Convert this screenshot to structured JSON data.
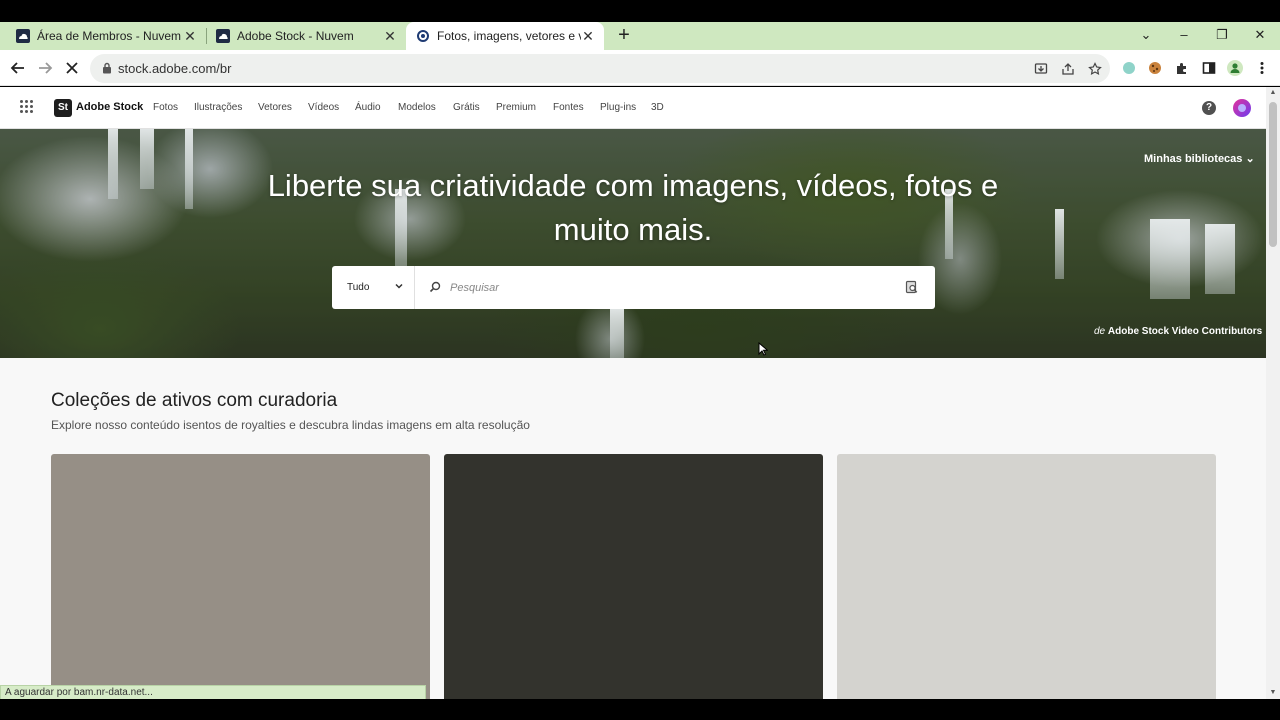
{
  "browser": {
    "tabs": [
      {
        "title": "Área de Membros - Nuvem",
        "active": false
      },
      {
        "title": "Adobe Stock - Nuvem",
        "active": false
      },
      {
        "title": "Fotos, imagens, vetores e vídeos",
        "active": true
      }
    ],
    "address": "stock.adobe.com/br",
    "status_text": "A aguardar por bam.nr-data.net..."
  },
  "header": {
    "logo_text": "St",
    "brand": "Adobe Stock",
    "nav": [
      "Fotos",
      "Ilustrações",
      "Vetores",
      "Vídeos",
      "Áudio",
      "Modelos",
      "Grátis",
      "Premium",
      "Fontes",
      "Plug-ins",
      "3D"
    ],
    "help_label": "?"
  },
  "hero": {
    "title": "Liberte sua criatividade com imagens, vídeos, fotos e muito mais.",
    "libraries": "Minhas bibliotecas",
    "credit_prefix": "de",
    "credit_name": "Adobe Stock Video Contributors",
    "search": {
      "category": "Tudo",
      "placeholder": "Pesquisar"
    }
  },
  "curated": {
    "title": "Coleções de ativos com curadoria",
    "subtitle": "Explore nosso conteúdo isentos de royalties e descubra lindas imagens em alta resolução",
    "card_colors": [
      "#968f86",
      "#33332d",
      "#d4d3cf"
    ]
  },
  "colors": {
    "tab_strip": "#cfe8c0",
    "accent_profile": "#e4329a"
  }
}
